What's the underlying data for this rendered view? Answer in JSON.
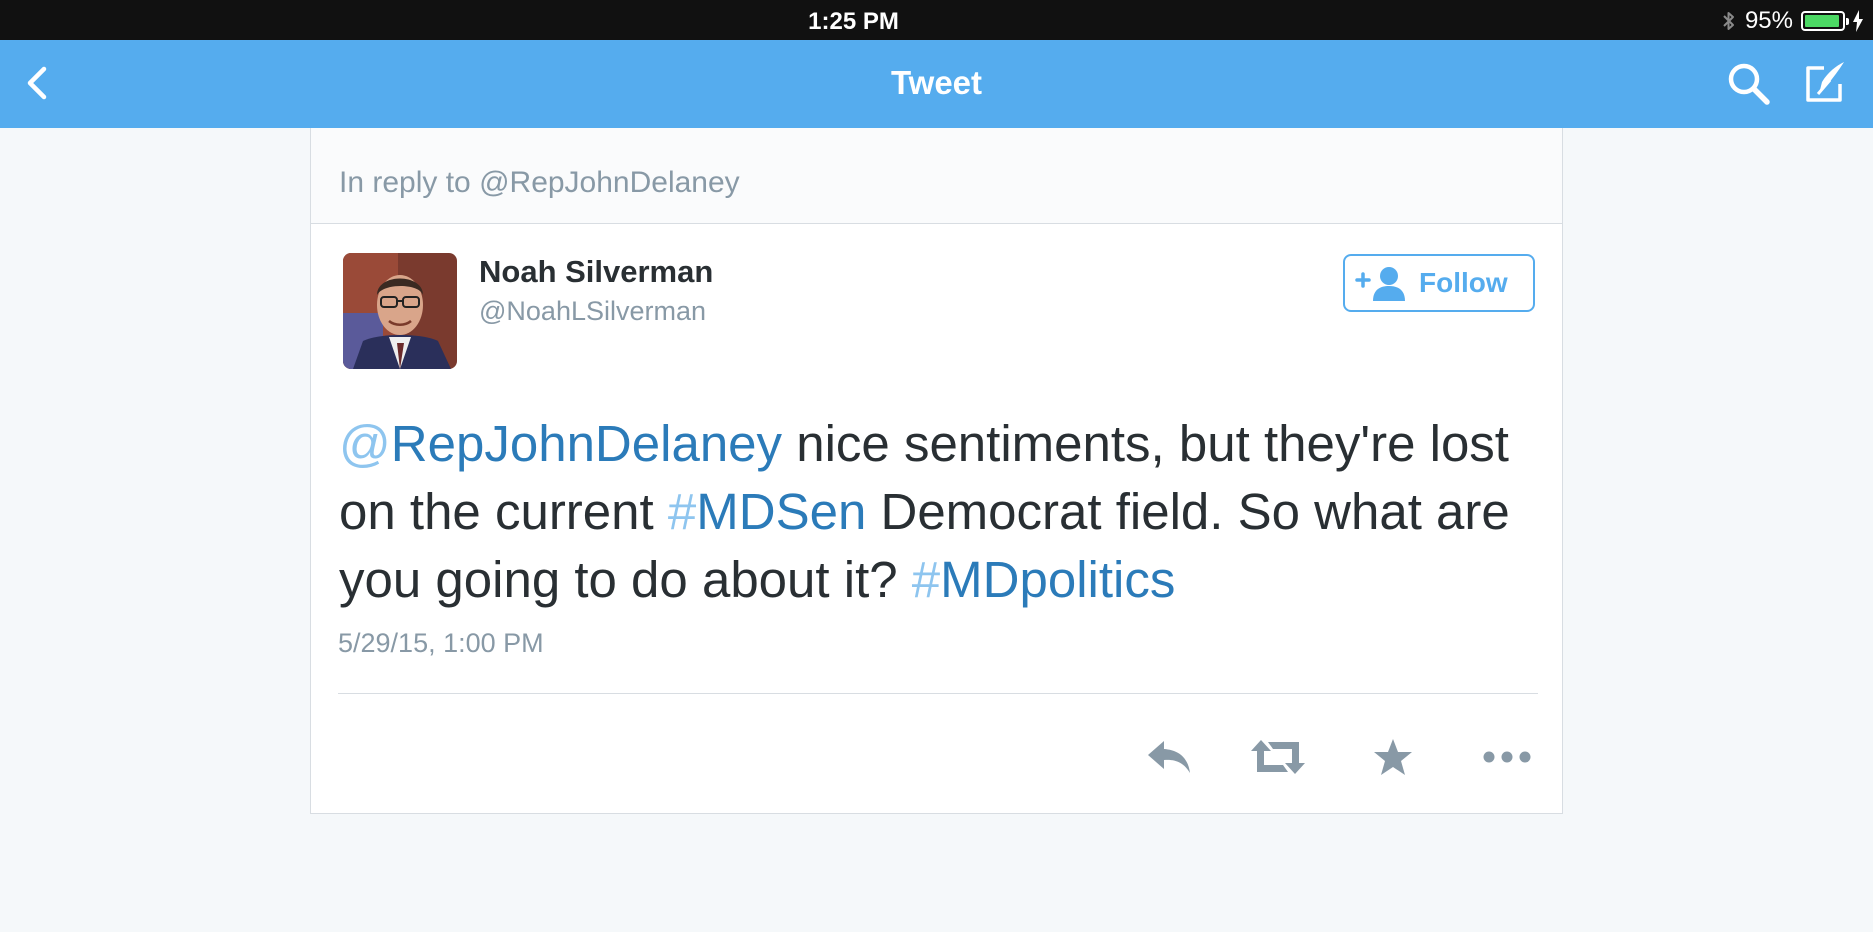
{
  "status_bar": {
    "time": "1:25 PM",
    "battery_percent": "95%",
    "battery_level": 0.95,
    "icons": [
      "bluetooth-icon",
      "battery-icon",
      "charging-bolt-icon"
    ]
  },
  "nav": {
    "title": "Tweet",
    "icons": [
      "back-chevron-icon",
      "search-icon",
      "compose-icon"
    ]
  },
  "tweet": {
    "reply_context": "In reply to @RepJohnDelaney",
    "author": {
      "name": "Noah Silverman",
      "handle": "@NoahLSilverman"
    },
    "follow_label": "Follow",
    "text": {
      "mention_prefix": "@",
      "mention": "RepJohnDelaney",
      "part1": " nice sentiments, but they're lost on the current ",
      "hashtag1_prefix": "#",
      "hashtag1": "MDSen",
      "part2": " Democrat field. So what are you going to do about it? ",
      "hashtag2_prefix": "#",
      "hashtag2": "MDpolitics"
    },
    "timestamp": "5/29/15, 1:00 PM",
    "actions": [
      "reply-icon",
      "retweet-icon",
      "favorite-star-icon",
      "more-dots-icon"
    ]
  },
  "colors": {
    "nav_blue": "#55acee",
    "link_blue": "#2b7bb9",
    "muted_gray": "#8899a6",
    "text_dark": "#292f33",
    "background": "#f5f8fa"
  }
}
